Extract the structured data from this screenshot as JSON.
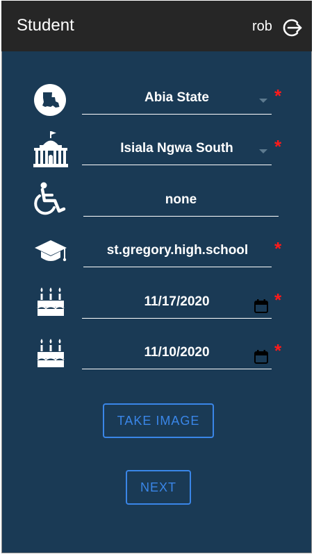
{
  "header": {
    "title": "Student",
    "username": "rob",
    "logout_icon": "logout-icon"
  },
  "form": {
    "state": {
      "value": "Abia State",
      "icon": "map-state-icon",
      "required_mark": "*"
    },
    "lga": {
      "value": "Isiala Ngwa South",
      "icon": "government-building-icon",
      "required_mark": "*"
    },
    "disability": {
      "value": "none",
      "icon": "wheelchair-icon"
    },
    "school": {
      "value": "st.gregory.high.school",
      "icon": "graduation-cap-icon",
      "required_mark": "*"
    },
    "date1": {
      "value": "11/17/2020",
      "icon": "birthday-cake-icon",
      "required_mark": "*"
    },
    "date2": {
      "value": "11/10/2020",
      "icon": "birthday-cake-icon",
      "required_mark": "*"
    }
  },
  "buttons": {
    "take_image": "TAKE IMAGE",
    "next": "NEXT"
  },
  "colors": {
    "background": "#1a3a55",
    "header": "#262626",
    "accent": "#3a86e8",
    "required": "#ff1a1a"
  }
}
